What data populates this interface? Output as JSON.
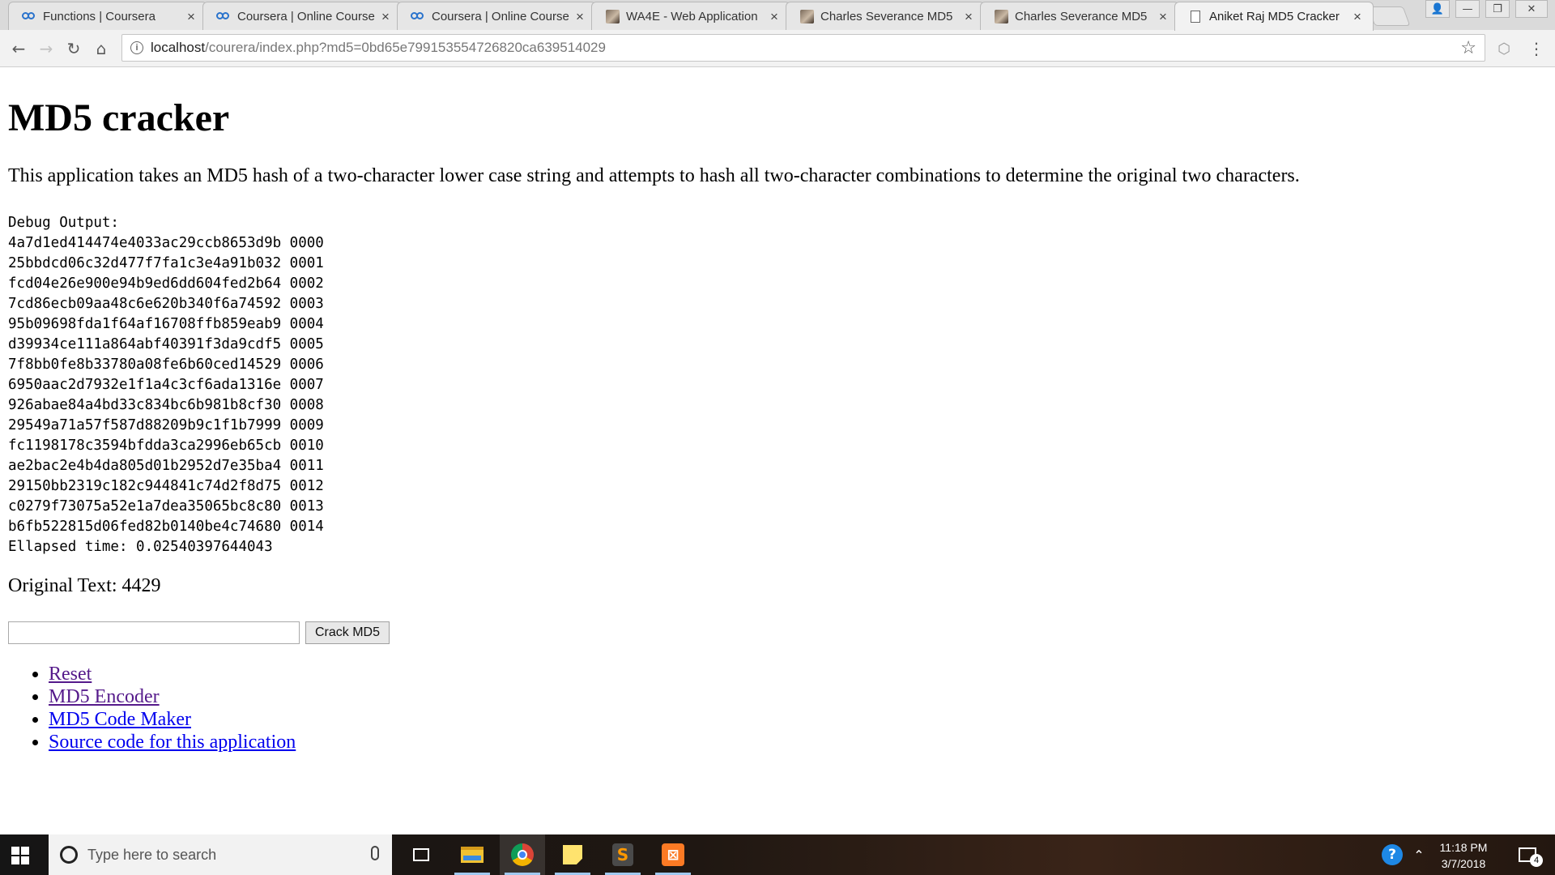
{
  "browser": {
    "tabs": [
      {
        "title": "Functions | Coursera",
        "favicon": "coursera-icon",
        "active": false
      },
      {
        "title": "Coursera | Online Course",
        "favicon": "coursera-icon",
        "active": false
      },
      {
        "title": "Coursera | Online Course",
        "favicon": "coursera-icon",
        "active": false
      },
      {
        "title": "WA4E - Web Application",
        "favicon": "photo-icon",
        "active": false
      },
      {
        "title": "Charles Severance MD5",
        "favicon": "photo-icon",
        "active": false
      },
      {
        "title": "Charles Severance MD5",
        "favicon": "photo-icon",
        "active": false
      },
      {
        "title": "Aniket Raj MD5 Cracker",
        "favicon": "document-icon",
        "active": true
      }
    ],
    "url_host": "localhost",
    "url_path": "/courera/index.php?md5=0bd65e799153554726820ca639514029"
  },
  "page": {
    "heading": "MD5 cracker",
    "description": "This application takes an MD5 hash of a two-character lower case string and attempts to hash all two-character combinations to determine the original two characters.",
    "debug_label": "Debug Output:",
    "debug_lines": [
      "4a7d1ed414474e4033ac29ccb8653d9b 0000",
      "25bbdcd06c32d477f7fa1c3e4a91b032 0001",
      "fcd04e26e900e94b9ed6dd604fed2b64 0002",
      "7cd86ecb09aa48c6e620b340f6a74592 0003",
      "95b09698fda1f64af16708ffb859eab9 0004",
      "d39934ce111a864abf40391f3da9cdf5 0005",
      "7f8bb0fe8b33780a08fe6b60ced14529 0006",
      "6950aac2d7932e1f1a4c3cf6ada1316e 0007",
      "926abae84a4bd33c834bc6b981b8cf30 0008",
      "29549a71a57f587d88209b9c1f1b7999 0009",
      "fc1198178c3594bfdda3ca2996eb65cb 0010",
      "ae2bac2e4b4da805d01b2952d7e35ba4 0011",
      "29150bb2319c182c944841c74d2f8d75 0012",
      "c0279f73075a52e1a7dea35065bc8c80 0013",
      "b6fb522815d06fed82b0140be4c74680 0014"
    ],
    "elapsed": "Ellapsed time: 0.02540397644043",
    "original_text": "Original Text: 4429",
    "input_value": "",
    "button_label": "Crack MD5",
    "links": [
      {
        "label": "Reset",
        "visited": true
      },
      {
        "label": "MD5 Encoder",
        "visited": true
      },
      {
        "label": "MD5 Code Maker",
        "visited": false
      },
      {
        "label": "Source code for this application",
        "visited": false
      }
    ]
  },
  "taskbar": {
    "search_placeholder": "Type here to search",
    "time": "11:18 PM",
    "date": "3/7/2018",
    "notification_count": "4",
    "accent": "#9fc8ef"
  }
}
